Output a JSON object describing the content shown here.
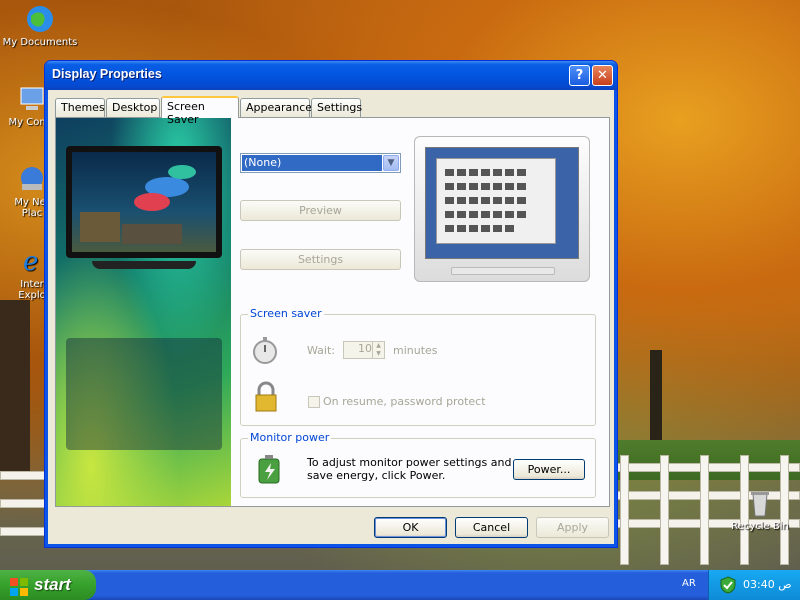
{
  "desktop": {
    "icons": [
      {
        "label": "My Documents",
        "icon": "globe-icon"
      },
      {
        "label": "My Comp",
        "icon": "computer-icon"
      },
      {
        "label": "My Net Plac",
        "icon": "network-icon"
      },
      {
        "label": "Inter Explo",
        "icon": "internet-explorer-icon"
      },
      {
        "label": "Recycle Bin",
        "icon": "recycle-bin-icon"
      }
    ]
  },
  "window": {
    "title": "Display Properties",
    "help_btn": "?",
    "close_btn": "✕",
    "tabs": [
      "Themes",
      "Desktop",
      "Screen Saver",
      "Appearance",
      "Settings"
    ],
    "active_tab": "Screen Saver"
  },
  "screensaver": {
    "selected": "(None)",
    "preview_label": "Preview",
    "settings_label": "Settings"
  },
  "screensaver_group": {
    "legend": "Screen saver",
    "wait_label": "Wait:",
    "wait_value": "10",
    "minutes_label": "minutes",
    "password_label": "On resume, password protect"
  },
  "monitor_group": {
    "legend": "Monitor power",
    "text": "To adjust monitor power settings and save energy, click Power.",
    "power_label": "Power..."
  },
  "footer": {
    "ok_label": "OK",
    "cancel_label": "Cancel",
    "apply_label": "Apply"
  },
  "taskbar": {
    "start_label": "start",
    "language": "AR",
    "clock": "03:40 ص"
  },
  "colors": {
    "title_blue": "#0255e0",
    "start_green": "#36a12c",
    "legend_blue": "#0046d5",
    "selection_blue": "#316ac5"
  }
}
